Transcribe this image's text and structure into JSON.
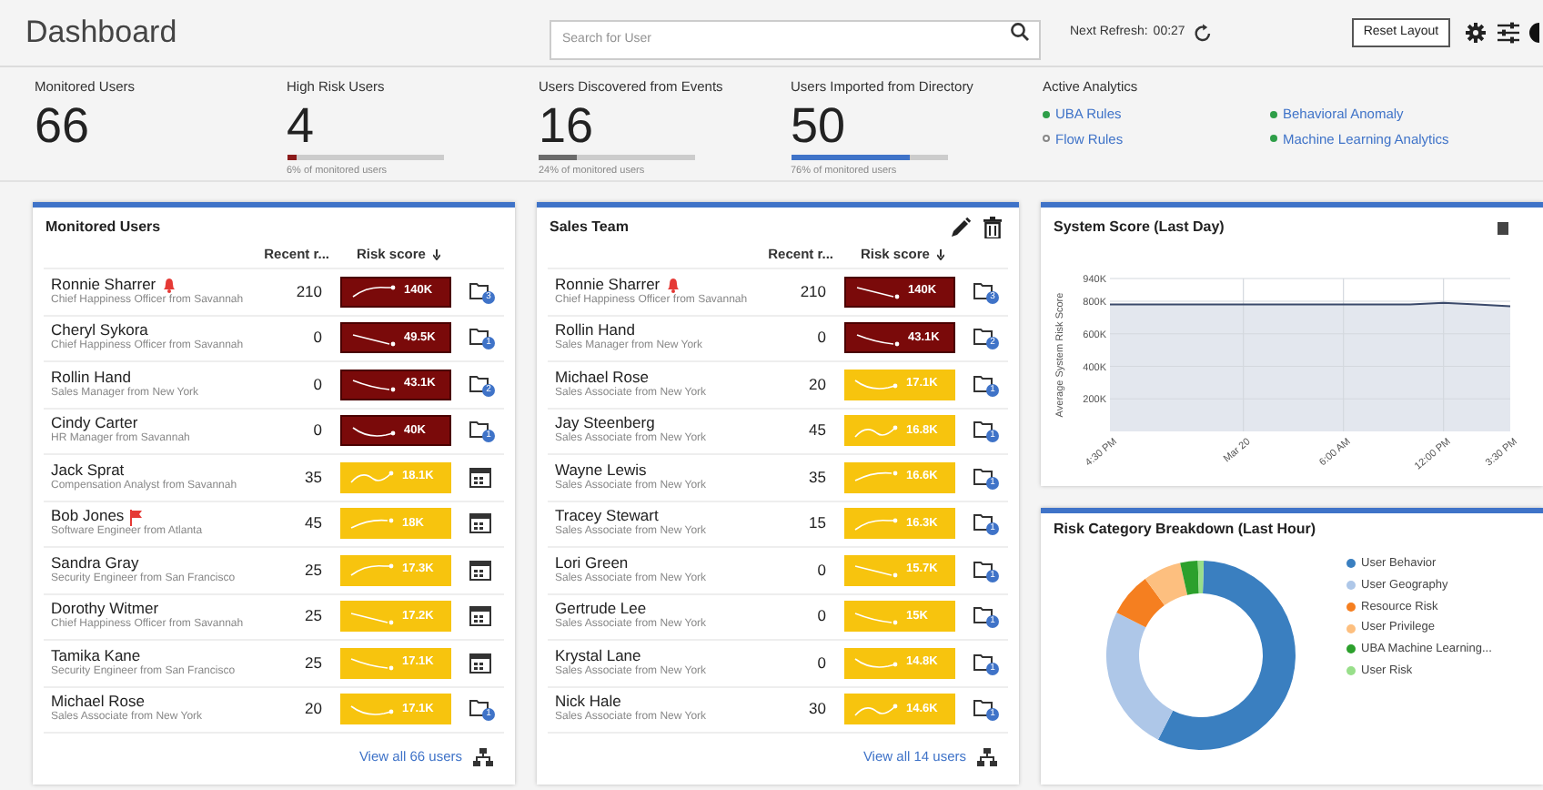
{
  "header": {
    "title": "Dashboard",
    "search": {
      "placeholder": "Search for User"
    },
    "refresh_label": "Next Refresh:",
    "refresh_time": "00:27",
    "reset_button": "Reset Layout"
  },
  "stats": [
    {
      "label": "Monitored Users",
      "value": "66"
    },
    {
      "label": "High Risk Users",
      "value": "4",
      "level": 0.06,
      "color": "#8b1a1a",
      "caption": "6% of monitored users"
    },
    {
      "label": "Users Discovered from Events",
      "value": "16",
      "level": 0.24,
      "color": "#6b6b6b",
      "caption": "24% of monitored users"
    },
    {
      "label": "Users Imported from Directory",
      "value": "50",
      "level": 0.76,
      "color": "#3f73c8",
      "caption": "76% of monitored users"
    }
  ],
  "active_analytics": {
    "title": "Active Analytics",
    "items": [
      {
        "label": "UBA Rules",
        "on": true
      },
      {
        "label": "Flow Rules",
        "on": false
      },
      {
        "label": "Behavioral Anomaly",
        "on": true
      },
      {
        "label": "Machine Learning Analytics",
        "on": true
      }
    ]
  },
  "panels": [
    {
      "title": "Monitored Users",
      "editable": false,
      "columns": [
        "Recent r...",
        "Risk score"
      ],
      "footer": "View all 66 users",
      "rows": [
        {
          "name": "Ronnie Sharrer",
          "marker": {
            "kind": "bell"
          },
          "subtitle": "Chief Happiness Officer from Savannah",
          "recent": "210",
          "score": "140K",
          "kind": "high",
          "badge": "3"
        },
        {
          "name": "Cheryl Sykora",
          "subtitle": "Chief Happiness Officer from Savannah",
          "recent": "0",
          "score": "49.5K",
          "kind": "high",
          "badge": "1"
        },
        {
          "name": "Rollin Hand",
          "subtitle": "Sales Manager from New York",
          "recent": "0",
          "score": "43.1K",
          "kind": "high",
          "badge": "2"
        },
        {
          "name": "Cindy Carter",
          "subtitle": "HR Manager from Savannah",
          "recent": "0",
          "score": "40K",
          "kind": "high",
          "badge": "1"
        },
        {
          "name": "Jack Sprat",
          "subtitle": "Compensation Analyst from Savannah",
          "recent": "35",
          "score": "18.1K",
          "kind": "medium"
        },
        {
          "name": "Bob Jones",
          "marker": {
            "kind": "flag"
          },
          "subtitle": "Software Engineer from Atlanta",
          "recent": "45",
          "score": "18K",
          "kind": "medium"
        },
        {
          "name": "Sandra Gray",
          "subtitle": "Security Engineer from San Francisco",
          "recent": "25",
          "score": "17.3K",
          "kind": "medium"
        },
        {
          "name": "Dorothy Witmer",
          "subtitle": "Chief Happiness Officer from Savannah",
          "recent": "25",
          "score": "17.2K",
          "kind": "medium"
        },
        {
          "name": "Tamika Kane",
          "subtitle": "Security Engineer from San Francisco",
          "recent": "25",
          "score": "17.1K",
          "kind": "medium"
        },
        {
          "name": "Michael Rose",
          "subtitle": "Sales Associate from New York",
          "recent": "20",
          "score": "17.1K",
          "kind": "medium",
          "badge": "1"
        }
      ]
    },
    {
      "title": "Sales Team",
      "editable": true,
      "columns": [
        "Recent r...",
        "Risk score"
      ],
      "footer": "View all 14 users",
      "rows": [
        {
          "name": "Ronnie Sharrer",
          "marker": {
            "kind": "bell"
          },
          "subtitle": "Chief Happiness Officer from Savannah",
          "recent": "210",
          "score": "140K",
          "kind": "high",
          "badge": "3"
        },
        {
          "name": "Rollin Hand",
          "subtitle": "Sales Manager from New York",
          "recent": "0",
          "score": "43.1K",
          "kind": "high",
          "badge": "2"
        },
        {
          "name": "Michael Rose",
          "subtitle": "Sales Associate from New York",
          "recent": "20",
          "score": "17.1K",
          "kind": "medium",
          "badge": "1"
        },
        {
          "name": "Jay Steenberg",
          "subtitle": "Sales Associate from New York",
          "recent": "45",
          "score": "16.8K",
          "kind": "medium",
          "badge": "1"
        },
        {
          "name": "Wayne Lewis",
          "subtitle": "Sales Associate from New York",
          "recent": "35",
          "score": "16.6K",
          "kind": "medium",
          "badge": "1"
        },
        {
          "name": "Tracey Stewart",
          "subtitle": "Sales Associate from New York",
          "recent": "15",
          "score": "16.3K",
          "kind": "medium",
          "badge": "1"
        },
        {
          "name": "Lori Green",
          "subtitle": "Sales Associate from New York",
          "recent": "0",
          "score": "15.7K",
          "kind": "medium",
          "badge": "1"
        },
        {
          "name": "Gertrude Lee",
          "subtitle": "Sales Associate from New York",
          "recent": "0",
          "score": "15K",
          "kind": "medium",
          "badge": "1"
        },
        {
          "name": "Krystal Lane",
          "subtitle": "Sales Associate from New York",
          "recent": "0",
          "score": "14.8K",
          "kind": "medium",
          "badge": "1"
        },
        {
          "name": "Nick Hale",
          "subtitle": "Sales Associate from New York",
          "recent": "30",
          "score": "14.6K",
          "kind": "medium",
          "badge": "1"
        }
      ]
    }
  ],
  "system_score": {
    "title": "System Score (Last Day)",
    "chart_data": {
      "type": "area",
      "grid": true,
      "ylabel": "Average System Risk Score",
      "categories": [
        "4:30 PM",
        null,
        null,
        null,
        "Mar 20",
        null,
        null,
        "6:00 AM",
        null,
        null,
        "12:00 PM",
        null,
        "3:30 PM"
      ],
      "ylim": [
        0,
        940000
      ],
      "yticks": [
        {
          "value": 200000,
          "label": "200K"
        },
        {
          "value": 400000,
          "label": "400K"
        },
        {
          "value": 600000,
          "label": "600K"
        },
        {
          "value": 800000,
          "label": "800K"
        },
        {
          "value": 940000,
          "label": "940K"
        }
      ],
      "series": [
        {
          "color": "#3b4a6b",
          "values": [
            780000,
            780000,
            780000,
            780000,
            780000,
            780000,
            780000,
            780000,
            780000,
            780000,
            790000,
            780000,
            770000
          ]
        }
      ]
    }
  },
  "risk_breakdown": {
    "title": "Risk Category Breakdown (Last Hour)",
    "legend": [
      {
        "label": "User Behavior",
        "color": "#3a7fc0"
      },
      {
        "label": "User Geography",
        "color": "#aec7e8"
      },
      {
        "label": "Resource Risk",
        "color": "#f57f20"
      },
      {
        "label": "User Privilege",
        "color": "#fdbf7f"
      },
      {
        "label": "UBA Machine Learning...",
        "color": "#2ca02c"
      },
      {
        "label": "User Risk",
        "color": "#98df8a"
      }
    ]
  }
}
